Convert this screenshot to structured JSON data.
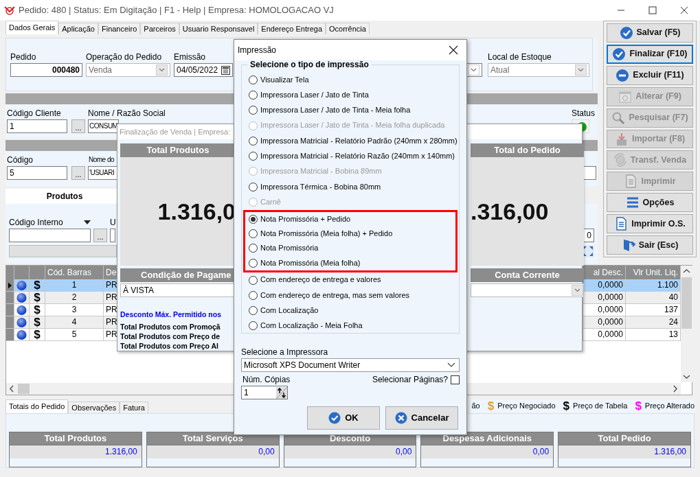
{
  "window": {
    "title": "Pedido: 480 | Status: Em Digitação | F1 - Help | Empresa: HOMOLOGACAO VJ"
  },
  "tabs": [
    {
      "label": "Dados Gerais",
      "selected": true
    },
    {
      "label": "Aplicação",
      "selected": false
    },
    {
      "label": "Financeiro",
      "selected": false
    },
    {
      "label": "Parceiros",
      "selected": false
    },
    {
      "label": "Usuario Responsavel",
      "selected": false
    },
    {
      "label": "Endereço Entrega",
      "selected": false
    },
    {
      "label": "Ocorrência",
      "selected": false
    }
  ],
  "header_fields": {
    "pedido": {
      "label": "Pedido",
      "value": "000480"
    },
    "operacao": {
      "label": "Operação do Pedido",
      "value": "Venda"
    },
    "emissao": {
      "label": "Emissão",
      "value": "04/05/2022"
    },
    "local_estoque": {
      "label": "Local de Estoque",
      "value": "Atual"
    }
  },
  "cliente": {
    "codigo_label": "Código Cliente",
    "codigo": "1",
    "browse": "...",
    "nome_label": "Nome / Razão Social",
    "nome": "CONSUM",
    "status_label": "Status"
  },
  "usuario": {
    "codigo_label": "Código",
    "codigo": "5",
    "browse": "...",
    "nome_label": "Nome do",
    "nome": "'USUARI"
  },
  "produtos": {
    "tab": "Produtos",
    "codigo_label": "Código Interno",
    "browse": "...",
    "u_label": "U",
    "quantity": "0"
  },
  "grid": {
    "columns_left": [
      "Cód. Barras",
      "De"
    ],
    "columns_right": [
      "al Desc.",
      "Vlr Unit. Liq."
    ],
    "rows": [
      {
        "selected": true,
        "price_icon": "$",
        "cod": "1",
        "desc": "PR",
        "desconto": "0,0000",
        "valor": "1.100"
      },
      {
        "selected": false,
        "price_icon": "$",
        "cod": "2",
        "desc": "PR",
        "desconto": "0,0000",
        "valor": "40"
      },
      {
        "selected": false,
        "price_icon": "$",
        "cod": "3",
        "desc": "PR",
        "desconto": "0,0000",
        "valor": "137"
      },
      {
        "selected": false,
        "price_icon": "$",
        "cod": "4",
        "desc": "PR",
        "desconto": "0,0000",
        "valor": "24"
      },
      {
        "selected": false,
        "price_icon": "$",
        "cod": "5",
        "desc": "PR",
        "desconto": "0,0000",
        "valor": "13"
      }
    ]
  },
  "bottom_tabs": [
    {
      "label": "Totais do Pedido",
      "selected": true
    },
    {
      "label": "Observações",
      "selected": false
    },
    {
      "label": "Fatura",
      "selected": false
    }
  ],
  "legend": [
    {
      "label": "ão"
    },
    {
      "icon": "$",
      "color": "#e0a030",
      "label": "Preço Negociado"
    },
    {
      "icon": "$",
      "color": "#000000",
      "label": "Preço de Tabela"
    },
    {
      "icon": "$",
      "color": "#ff00ff",
      "label": "Preço Alterado"
    }
  ],
  "totals": [
    {
      "label": "Total Produtos",
      "value": "1.316,00"
    },
    {
      "label": "Total Serviços",
      "value": "0,00"
    },
    {
      "label": "Desconto",
      "value": "0,00"
    },
    {
      "label": "Despesas Adicionais",
      "value": "0,00"
    },
    {
      "label": "Total Pedido",
      "value": "1.316,00"
    }
  ],
  "side_buttons": [
    {
      "label": "Salvar (F5)",
      "disabled": false,
      "focused": false
    },
    {
      "label": "Finalizar (F10)",
      "disabled": false,
      "focused": true
    },
    {
      "label": "Excluir (F11)",
      "disabled": false,
      "focused": false
    },
    {
      "label": "Alterar (F9)",
      "disabled": true,
      "focused": false
    },
    {
      "label": "Pesquisar (F7)",
      "disabled": true,
      "focused": false
    },
    {
      "label": "Importar (F8)",
      "disabled": true,
      "focused": false
    },
    {
      "label": "Transf. Venda",
      "disabled": true,
      "focused": false
    },
    {
      "label": "Imprimir",
      "disabled": true,
      "focused": false
    },
    {
      "label": "Opções",
      "disabled": false,
      "focused": false
    },
    {
      "label": "Imprimir O.S.",
      "disabled": false,
      "focused": false
    },
    {
      "label": "Sair (Esc)",
      "disabled": false,
      "focused": false
    }
  ],
  "finalizacao": {
    "title": "Finalização de Venda | Empresa:",
    "total_produtos_label": "Total Produtos",
    "total_produtos": "1.316,0",
    "total_pedido_label": "Total do Pedido",
    "total_pedido": ".316,00",
    "condicao_label": "Condição de Pagame",
    "condicao": "À VISTA",
    "conta_label": "Conta Corrente",
    "notes": [
      {
        "kind": "highlight",
        "text": "Desconto Máx. Permitido nos"
      },
      {
        "kind": "plain",
        "text": "Total Produtos com Promoçã"
      },
      {
        "kind": "plain",
        "text": "Total Produtos com Preço de"
      },
      {
        "kind": "plain",
        "text": "Total Produtos com Preço Al"
      }
    ]
  },
  "impressao": {
    "title": "Impressão",
    "group_label": "Selecione o tipo de impressão",
    "options": [
      {
        "label": "Visualizar Tela",
        "selected": false,
        "disabled": false,
        "highlighted": false
      },
      {
        "label": "Impressora Laser / Jato de Tinta",
        "selected": false,
        "disabled": false,
        "highlighted": false
      },
      {
        "label": "Impressora Laser / Jato de Tinta - Meia folha",
        "selected": false,
        "disabled": false,
        "highlighted": false
      },
      {
        "label": "Impressora Laser / Jato de Tinta - Meia folha duplicada",
        "selected": false,
        "disabled": true,
        "highlighted": false
      },
      {
        "label": "Impressora Matricial - Relatório Padrão (240mm x 280mm)",
        "selected": false,
        "disabled": false,
        "highlighted": false
      },
      {
        "label": "Impressora Matricial - Relatório Razão (240mm x 140mm)",
        "selected": false,
        "disabled": false,
        "highlighted": false
      },
      {
        "label": "Impressora Matricial - Bobina 89mm",
        "selected": false,
        "disabled": true,
        "highlighted": false
      },
      {
        "label": "Impressora Térmica - Bobina 80mm",
        "selected": false,
        "disabled": false,
        "highlighted": false
      },
      {
        "label": "Carnê",
        "selected": false,
        "disabled": true,
        "highlighted": false
      },
      {
        "label": "Nota Promissória + Pedido",
        "selected": true,
        "disabled": false,
        "highlighted": true
      },
      {
        "label": "Nota Promissória (Meia folha) + Pedido",
        "selected": false,
        "disabled": false,
        "highlighted": true
      },
      {
        "label": "Nota Promissória",
        "selected": false,
        "disabled": false,
        "highlighted": true
      },
      {
        "label": "Nota Promissória (Meia folha)",
        "selected": false,
        "disabled": false,
        "highlighted": true
      },
      {
        "label": "Com endereço de entrega e valores",
        "selected": false,
        "disabled": false,
        "highlighted": false
      },
      {
        "label": "Com endereço de entrega, mas sem valores",
        "selected": false,
        "disabled": false,
        "highlighted": false
      },
      {
        "label": "Com Localização",
        "selected": false,
        "disabled": false,
        "highlighted": false
      },
      {
        "label": "Com Localização - Meia Folha",
        "selected": false,
        "disabled": false,
        "highlighted": false
      }
    ],
    "printer_label": "Selecione a Impressora",
    "printer": "Microsoft XPS Document Writer",
    "copies_label": "Núm. Cópias",
    "copies": "1",
    "pages_label": "Selecionar Páginas?",
    "pages_checked": false,
    "buttons": [
      {
        "kind": "ok",
        "label": "OK"
      },
      {
        "kind": "cancel",
        "label": "Cancelar"
      }
    ]
  }
}
